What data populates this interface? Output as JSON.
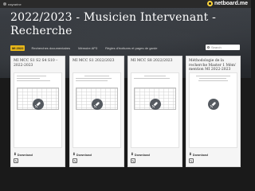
{
  "topbar": {
    "user_label": "eayrarine",
    "brand": "netboard.me"
  },
  "header": {
    "title_line1": "2022/2023 - Musicien Intervenant -",
    "title_line2": "Recherche"
  },
  "nav": {
    "tabs": [
      {
        "label": "MI 2022",
        "active": true
      },
      {
        "label": "Recherches documentaires",
        "active": false
      },
      {
        "label": "Mémoire AP3",
        "active": false
      },
      {
        "label": "Règles d'écritures et pages de garde",
        "active": false
      }
    ]
  },
  "search": {
    "placeholder": "Search"
  },
  "cards": [
    {
      "title": "MI MCC S1 S2 S4 S10 – 2022-2023",
      "download_label": "Download"
    },
    {
      "title": "MI MCC S1 2022/2023",
      "download_label": "Download"
    },
    {
      "title": "MI MCC S8 2022/2023",
      "download_label": "Download"
    },
    {
      "title": "Méthodologie de la recherche Master 1 Mém’ mention MI 2022-2023",
      "download_label": "Download"
    }
  ],
  "colors": {
    "accent": "#e8b71a",
    "background": "#1a1a1a",
    "card": "#f5f5f5"
  }
}
